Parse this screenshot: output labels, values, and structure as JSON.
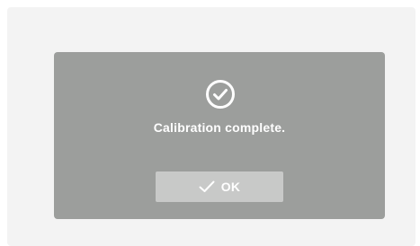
{
  "dialog": {
    "icon": "check-circle-icon",
    "message": "Calibration complete.",
    "ok_button": {
      "icon": "checkmark-icon",
      "label": "OK"
    }
  },
  "colors": {
    "screen_background": "#f3f3f3",
    "dialog_background": "#9c9e9c",
    "button_background": "#c8c9c8",
    "text": "#ffffff"
  }
}
